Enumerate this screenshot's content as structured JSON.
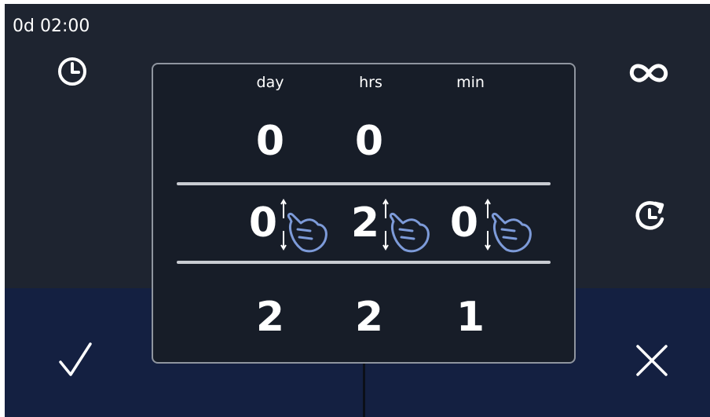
{
  "status": {
    "elapsed_time": "0d 02:00"
  },
  "dialog": {
    "columns": [
      {
        "label": "day",
        "prev": "0",
        "selected": "0",
        "next": "2"
      },
      {
        "label": "hrs",
        "prev": "0",
        "selected": "2",
        "next": "2"
      },
      {
        "label": "min",
        "prev": "",
        "selected": "0",
        "next": "1"
      }
    ]
  },
  "icons": {
    "clock": "clock-icon",
    "infinity": "infinity-icon",
    "restart": "restart-timer-icon",
    "confirm": "checkmark-icon",
    "cancel": "close-icon",
    "scroll_hint": "swipe-hand-icon"
  },
  "colors": {
    "screen_bg": "#1e2430",
    "bottom_bg": "#142041",
    "dialog_bg": "#171d28",
    "hand_accent": "#7d9bd9"
  }
}
